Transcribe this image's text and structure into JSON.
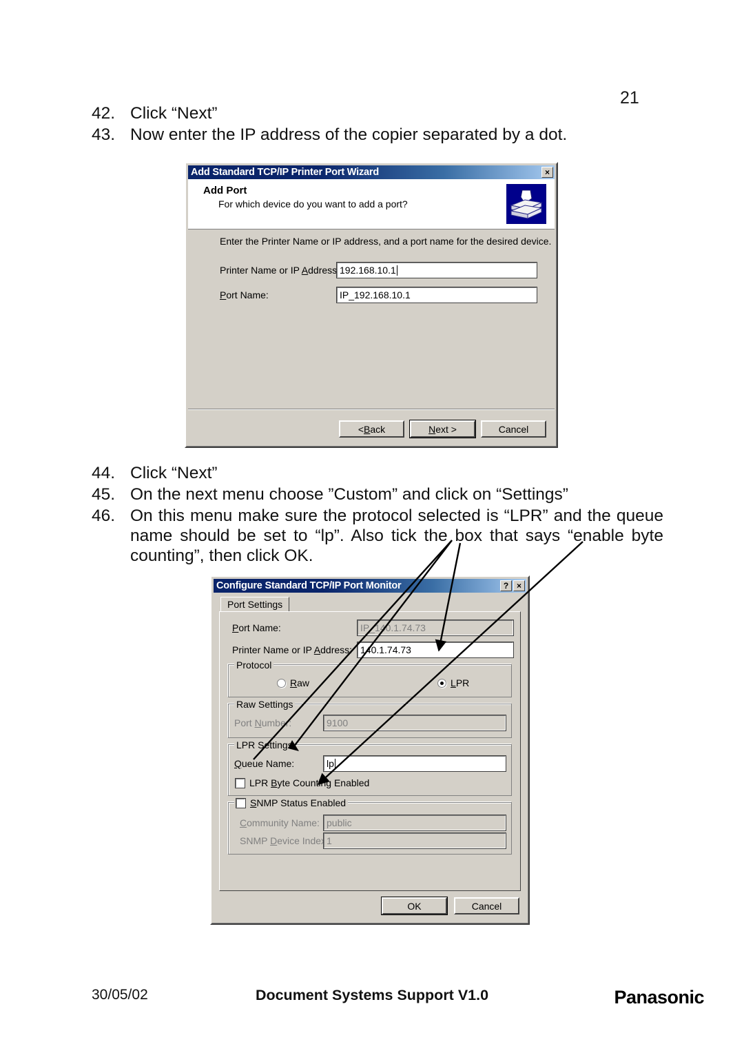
{
  "page": {
    "number": "21"
  },
  "instructions_top": [
    {
      "num": "42.",
      "text": "Click “Next”"
    },
    {
      "num": "43.",
      "text": "Now enter the IP address of the copier separated by a dot."
    }
  ],
  "instructions_mid": [
    {
      "num": "44.",
      "text": "Click “Next”"
    },
    {
      "num": "45.",
      "text": "On the next menu choose ”Custom” and click on “Settings”"
    },
    {
      "num": "46.",
      "text": "On this menu make sure the protocol selected is “LPR” and the queue name should be set to “lp”. Also tick the box that says “enable byte counting”, then click OK."
    }
  ],
  "dialog_add_port": {
    "title": "Add Standard TCP/IP Printer Port Wizard",
    "close_label": "×",
    "header_title": "Add Port",
    "header_subtitle": "For which device do you want to add a port?",
    "icon": "printer-icon",
    "instruction": "Enter the Printer Name or IP address, and a port name for the desired device.",
    "fields": [
      {
        "label": "Printer Name or IP Address:",
        "value": "192.168.10.1",
        "focused": true
      },
      {
        "label": "Port Name:",
        "value": "IP_192.168.10.1",
        "focused": false
      }
    ],
    "buttons": {
      "back": "< Back",
      "next": "Next >",
      "cancel": "Cancel"
    }
  },
  "dialog_port_monitor": {
    "title": "Configure Standard TCP/IP Port Monitor",
    "help_label": "?",
    "close_label": "×",
    "tab": "Port Settings",
    "fields": [
      {
        "label": "Port Name:",
        "value": "IP_140.1.74.73",
        "disabled": true
      },
      {
        "label": "Printer Name or IP Address:",
        "value": "140.1.74.73",
        "disabled": false
      }
    ],
    "protocol": {
      "group_label": "Protocol",
      "options": [
        {
          "label": "Raw",
          "selected": false
        },
        {
          "label": "LPR",
          "selected": true
        }
      ]
    },
    "raw_settings": {
      "group_label": "Raw Settings",
      "port_number_label": "Port Number:",
      "port_number_value": "9100",
      "disabled": true
    },
    "lpr_settings": {
      "group_label": "LPR Settings",
      "queue_name_label": "Queue Name:",
      "queue_name_value": "lp",
      "byte_counting_label": "LPR Byte Counting Enabled",
      "byte_counting_checked": false
    },
    "snmp_settings": {
      "group_label": "SNMP Status Enabled",
      "enabled": false,
      "community_name_label": "Community Name:",
      "community_name_value": "public",
      "device_index_label": "SNMP Device Index:",
      "device_index_value": "1"
    },
    "buttons": {
      "ok": "OK",
      "cancel": "Cancel"
    }
  },
  "annotations": [
    {
      "name": "arrow-to-port-settings-tab",
      "target": "Port Settings tab"
    },
    {
      "name": "arrow-to-printer-name-field",
      "target": "Printer Name or IP Address field"
    },
    {
      "name": "arrow-to-lpr-byte-counting",
      "target": "LPR Byte Counting Enabled checkbox"
    }
  ],
  "footer": {
    "date": "30/05/02",
    "center": "Document Systems Support V1.0",
    "brand": "Panasonic"
  },
  "colors": {
    "dialog_face": "#d4d0c8",
    "titlebar_dark": "#0a246a",
    "titlebar_light": "#a6caf0",
    "icon_bg": "#00008b"
  }
}
